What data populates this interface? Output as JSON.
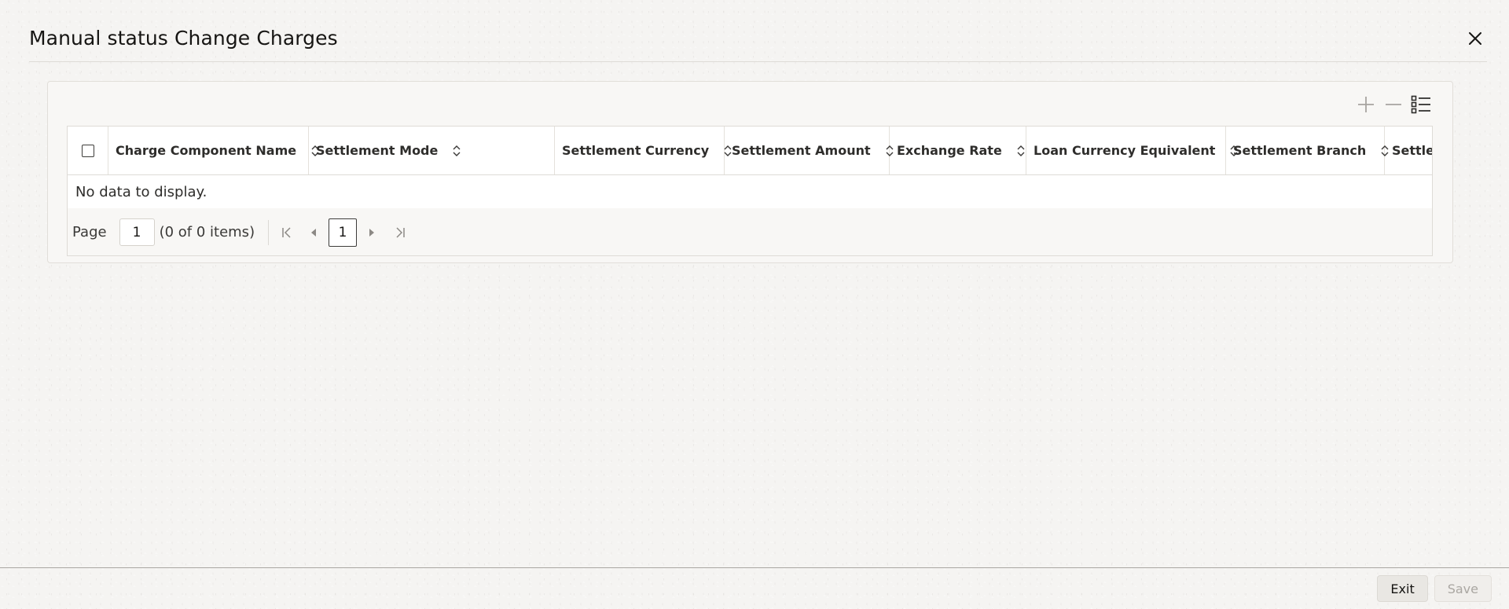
{
  "dialog": {
    "title": "Manual status Change Charges"
  },
  "table": {
    "columns": [
      {
        "label": "Charge Component Name"
      },
      {
        "label": "Settlement Mode"
      },
      {
        "label": "Settlement Currency"
      },
      {
        "label": "Settlement Amount"
      },
      {
        "label": "Exchange Rate"
      },
      {
        "label": "Loan Currency Equivalent"
      },
      {
        "label": "Settlement Branch"
      },
      {
        "label": "Settlem"
      }
    ],
    "empty_message": "No data to display."
  },
  "pagination": {
    "page_label": "Page",
    "page_value": "1",
    "items_summary": "(0 of 0 items)",
    "current_page": "1"
  },
  "footer": {
    "exit_label": "Exit",
    "save_label": "Save"
  },
  "icons": {
    "close": "close-icon",
    "add": "plus-icon",
    "remove": "minus-icon",
    "columns": "column-list-icon",
    "sort": "sort-icon",
    "first": "first-page-icon",
    "prev": "previous-page-icon",
    "next": "next-page-icon",
    "last": "last-page-icon"
  },
  "colors": {
    "background": "#f5f4f2",
    "text": "#161513",
    "disabled_text": "#aaa7a2",
    "border": "#dedbd6"
  }
}
